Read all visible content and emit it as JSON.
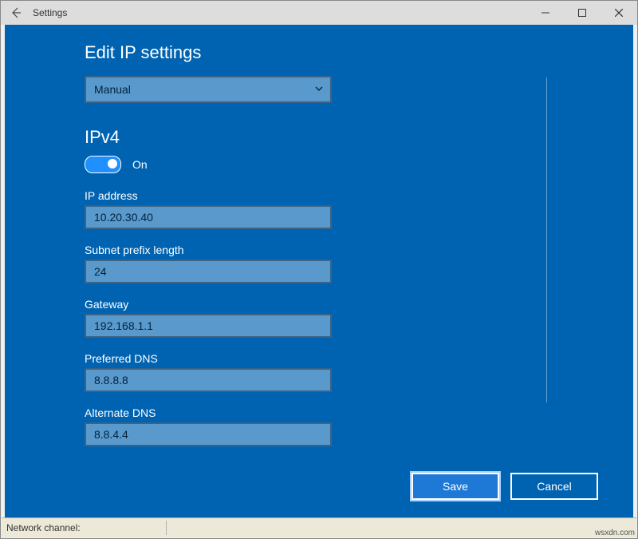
{
  "window": {
    "title": "Settings"
  },
  "modal": {
    "title": "Edit IP settings",
    "mode_selected": "Manual",
    "ipv4_heading": "IPv4",
    "ipv4_toggle_label": "On",
    "fields": {
      "ip_address": {
        "label": "IP address",
        "value": "10.20.30.40"
      },
      "subnet_prefix": {
        "label": "Subnet prefix length",
        "value": "24"
      },
      "gateway": {
        "label": "Gateway",
        "value": "192.168.1.1"
      },
      "preferred_dns": {
        "label": "Preferred DNS",
        "value": "8.8.8.8"
      },
      "alternate_dns": {
        "label": "Alternate DNS",
        "value": "8.8.4.4"
      }
    },
    "buttons": {
      "save": "Save",
      "cancel": "Cancel"
    }
  },
  "footer": {
    "network_channel_label": "Network channel:"
  },
  "watermark": "wsxdn.com"
}
